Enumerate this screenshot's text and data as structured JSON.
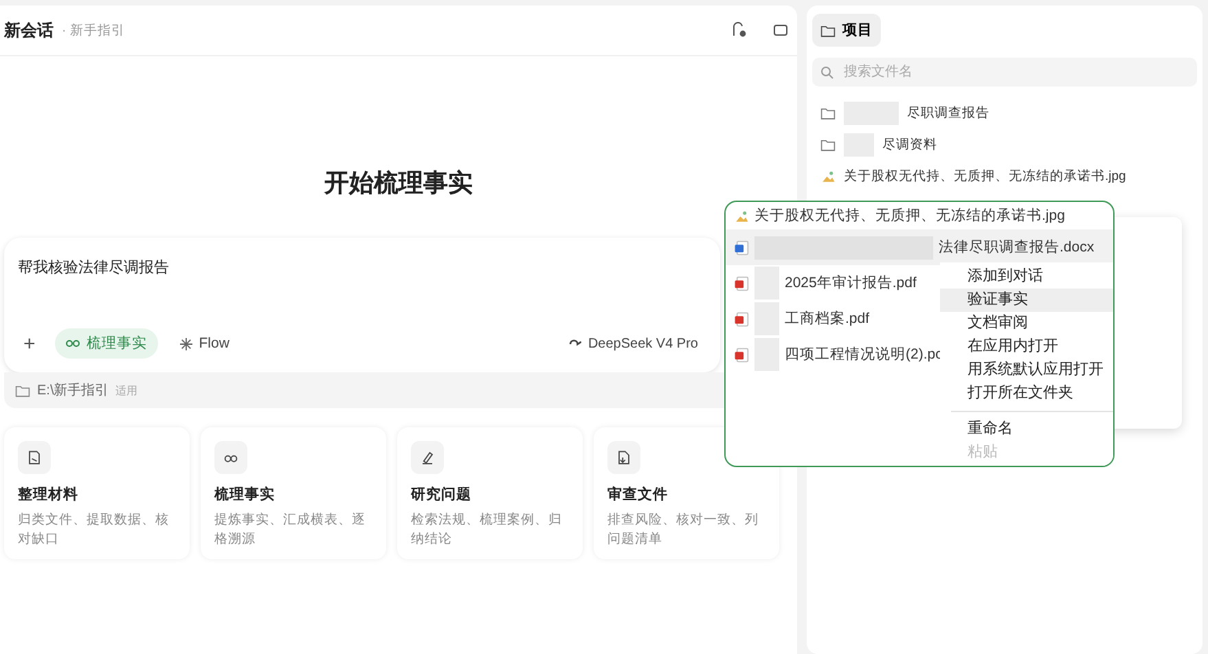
{
  "header": {
    "title": "新会话",
    "subtitle": "· 新手指引"
  },
  "heading": "开始梳理事实",
  "composer": {
    "text": "帮我核验法律尽调报告",
    "add": "+",
    "mode": {
      "label": "梳理事实",
      "selected": true
    },
    "flow": "Flow",
    "model": "DeepSeek V4 Pro"
  },
  "path": {
    "label": "E:\\新手指引",
    "tag": "适用"
  },
  "cards": [
    {
      "title": "整理材料",
      "desc": "归类文件、提取数据、核对缺口"
    },
    {
      "title": "梳理事实",
      "desc": "提炼事实、汇成横表、逐格溯源"
    },
    {
      "title": "研究问题",
      "desc": "检索法规、梳理案例、归纳结论"
    },
    {
      "title": "审查文件",
      "desc": "排查风险、核对一致、列问题清单"
    }
  ],
  "project_panel": {
    "tab": "项目",
    "search": {
      "placeholder": "搜索文件名"
    },
    "items": [
      {
        "kind": "folder",
        "name": "尽职调查报告"
      },
      {
        "kind": "folder",
        "name": "尽调资料"
      },
      {
        "kind": "image",
        "name": "关于股权无代持、无质押、无冻结的承诺书.jpg"
      }
    ]
  },
  "zoom_popup": {
    "files": [
      {
        "kind": "image",
        "name": "关于股权无代持、无质押、无冻结的承诺书.jpg",
        "selected": false
      },
      {
        "kind": "docx",
        "name": "法律尽职调查报告.docx",
        "selected": true
      },
      {
        "kind": "pdf",
        "name": "2025年审计报告.pdf",
        "selected": false
      },
      {
        "kind": "pdf",
        "name": "工商档案.pdf",
        "selected": false
      },
      {
        "kind": "pdf",
        "name": "四项工程情况说明(2).pc",
        "selected": false
      }
    ],
    "menu": [
      {
        "label": "添加到对话",
        "selected": false,
        "disabled": false
      },
      {
        "label": "验证事实",
        "selected": true,
        "disabled": false
      },
      {
        "label": "文档审阅",
        "selected": false,
        "disabled": false
      },
      {
        "label": "在应用内打开",
        "selected": false,
        "disabled": false
      },
      {
        "label": "用系统默认应用打开",
        "selected": false,
        "disabled": false
      },
      {
        "label": "打开所在文件夹",
        "selected": false,
        "disabled": false,
        "divider_after": true
      },
      {
        "label": "重命名",
        "selected": false,
        "disabled": false
      },
      {
        "label": "粘贴",
        "selected": false,
        "disabled": true
      }
    ]
  }
}
